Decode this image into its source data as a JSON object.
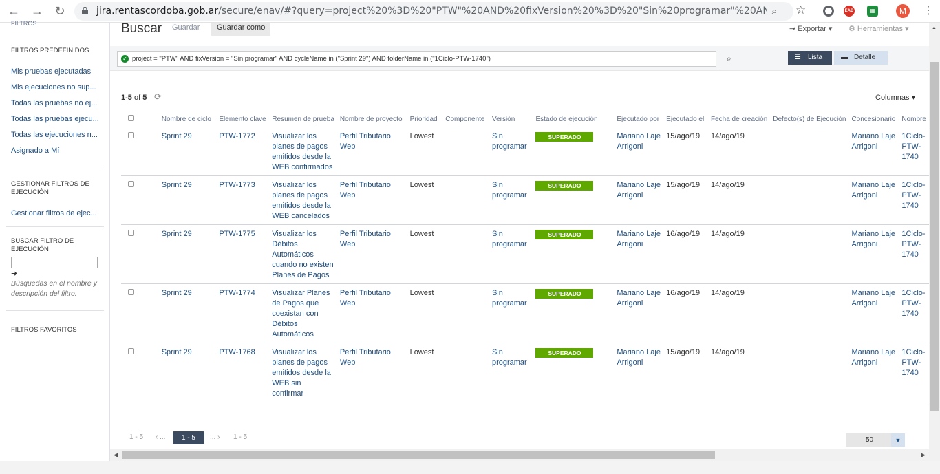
{
  "browser": {
    "url_host": "jira.rentascordoba.gob.ar",
    "url_rest": "/secure/enav/#?query=project%20%3D%20\"PTW\"%20AND%20fixVersion%20%3D%20\"Sin%20programar\"%20AND%20cycleNam...",
    "profile_initial": "M",
    "ext2_label": "EAB"
  },
  "sidebar": {
    "cut_label": "FILTROS",
    "predefined_heading": "FILTROS PREDEFINIDOS",
    "predefined": [
      "Mis pruebas ejecutadas",
      "Mis ejecuciones no sup...",
      "Todas las pruebas no ej...",
      "Todas las pruebas ejecu...",
      "Todas las ejecuciones n...",
      "Asignado a Mí"
    ],
    "manage_heading": "GESTIONAR FILTROS DE EJECUCIÓN",
    "manage_link": "Gestionar filtros de ejec...",
    "search_heading": "BUSCAR FILTRO DE EJECUCIÓN",
    "search_arrow": "➜",
    "search_hint": "Búsquedas en el nombre y descripción del filtro.",
    "favorites_heading": "FILTROS FAVORITOS"
  },
  "header": {
    "title": "Buscar",
    "save": "Guardar",
    "save_as": "Guardar como",
    "export": "Exportar",
    "tools": "Herramientas"
  },
  "query": "project = \"PTW\" AND fixVersion = \"Sin programar\" AND cycleName in (\"Sprint 29\") AND folderName in (\"1Ciclo-PTW-1740\")",
  "views": {
    "list": "Lista",
    "detail": "Detalle"
  },
  "results": {
    "range": "1-5",
    "of": "of",
    "total": "5",
    "columns": "Columnas"
  },
  "table": {
    "headers": [
      "Nombre de ciclo",
      "Elemento clave",
      "Resumen de prueba",
      "Nombre de proyecto",
      "Prioridad",
      "Componente",
      "Versión",
      "Estado de ejecución",
      "Ejecutado por",
      "Ejecutado el",
      "Fecha de creación",
      "Defecto(s) de Ejecución",
      "Concesionario",
      "Nombre"
    ],
    "rows": [
      {
        "cycle": "Sprint 29",
        "key": "PTW-1772",
        "summary": "Visualizar los planes de pagos emitidos desde la WEB confirmados",
        "project": "Perfil Tributario Web",
        "priority": "Lowest",
        "component": "",
        "version": "Sin programar",
        "status": "SUPERADO",
        "executed_by": "Mariano Laje Arrigoni",
        "executed_on": "15/ago/19",
        "created": "14/ago/19",
        "defects": "",
        "assignee": "Mariano Laje Arrigoni",
        "folder": "1Ciclo-PTW-1740"
      },
      {
        "cycle": "Sprint 29",
        "key": "PTW-1773",
        "summary": "Visualizar los planes de pagos emitidos desde la WEB cancelados",
        "project": "Perfil Tributario Web",
        "priority": "Lowest",
        "component": "",
        "version": "Sin programar",
        "status": "SUPERADO",
        "executed_by": "Mariano Laje Arrigoni",
        "executed_on": "15/ago/19",
        "created": "14/ago/19",
        "defects": "",
        "assignee": "Mariano Laje Arrigoni",
        "folder": "1Ciclo-PTW-1740"
      },
      {
        "cycle": "Sprint 29",
        "key": "PTW-1775",
        "summary": "Visualizar los Débitos Automáticos cuando no existen Planes de Pagos",
        "project": "Perfil Tributario Web",
        "priority": "Lowest",
        "component": "",
        "version": "Sin programar",
        "status": "SUPERADO",
        "executed_by": "Mariano Laje Arrigoni",
        "executed_on": "16/ago/19",
        "created": "14/ago/19",
        "defects": "",
        "assignee": "Mariano Laje Arrigoni",
        "folder": "1Ciclo-PTW-1740"
      },
      {
        "cycle": "Sprint 29",
        "key": "PTW-1774",
        "summary": "Visualizar Planes de Pagos que coexistan con Débitos Automáticos",
        "project": "Perfil Tributario Web",
        "priority": "Lowest",
        "component": "",
        "version": "Sin programar",
        "status": "SUPERADO",
        "executed_by": "Mariano Laje Arrigoni",
        "executed_on": "16/ago/19",
        "created": "14/ago/19",
        "defects": "",
        "assignee": "Mariano Laje Arrigoni",
        "folder": "1Ciclo-PTW-1740"
      },
      {
        "cycle": "Sprint 29",
        "key": "PTW-1768",
        "summary": "Visualizar los planes de pagos emitidos desde la WEB sin confirmar",
        "project": "Perfil Tributario Web",
        "priority": "Lowest",
        "component": "",
        "version": "Sin programar",
        "status": "SUPERADO",
        "executed_by": "Mariano Laje Arrigoni",
        "executed_on": "15/ago/19",
        "created": "14/ago/19",
        "defects": "",
        "assignee": "Mariano Laje Arrigoni",
        "folder": "1Ciclo-PTW-1740"
      }
    ]
  },
  "pagination": {
    "first": "1 - 5",
    "prev": "‹ ...",
    "current": "1 - 5",
    "next": "... ›",
    "last": "1 - 5",
    "per_page": "50"
  },
  "colors": {
    "link": "#205081",
    "badge": "#5fa800",
    "active_view": "#3b4a5f"
  }
}
